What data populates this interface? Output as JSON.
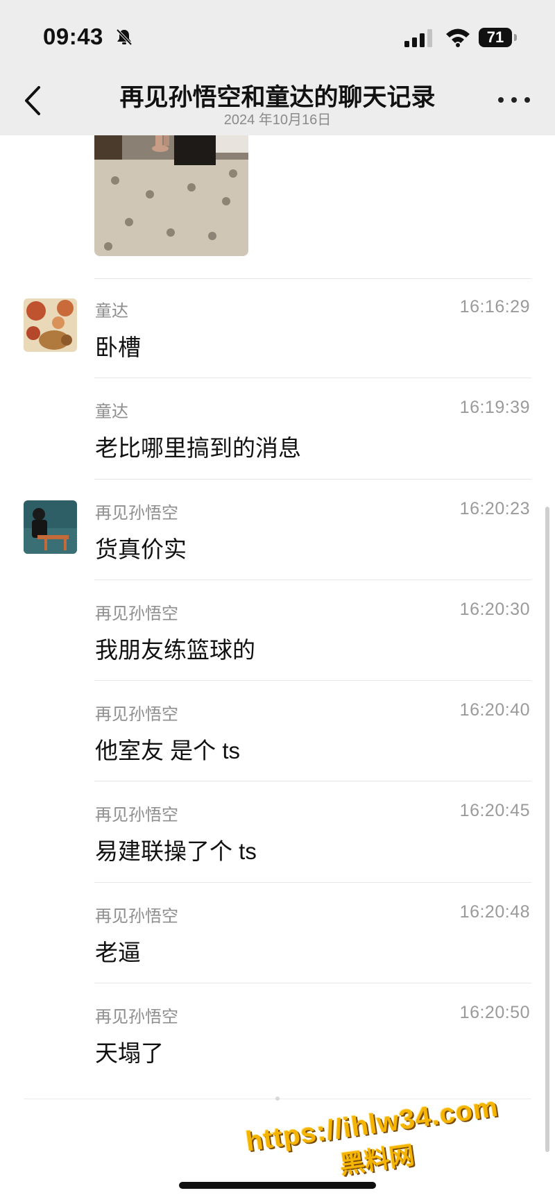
{
  "status_bar": {
    "time": "09:43",
    "battery": "71"
  },
  "nav": {
    "title": "再见孙悟空和童达的聊天记录",
    "subtitle": "2024 年10月16日"
  },
  "messages": [
    {
      "sender": "童达",
      "time": "16:16:29",
      "text": "卧槽"
    },
    {
      "sender": "童达",
      "time": "16:19:39",
      "text": "老比哪里搞到的消息"
    },
    {
      "sender": "再见孙悟空",
      "time": "16:20:23",
      "text": "货真价实"
    },
    {
      "sender": "再见孙悟空",
      "time": "16:20:30",
      "text": "我朋友练篮球的"
    },
    {
      "sender": "再见孙悟空",
      "time": "16:20:40",
      "text": "他室友 是个 ts"
    },
    {
      "sender": "再见孙悟空",
      "time": "16:20:45",
      "text": "易建联操了个 ts"
    },
    {
      "sender": "再见孙悟空",
      "time": "16:20:48",
      "text": "老逼"
    },
    {
      "sender": "再见孙悟空",
      "time": "16:20:50",
      "text": "天塌了"
    }
  ],
  "watermark": {
    "url": "https://ihlw34.com",
    "site": "黑料网"
  },
  "colors": {
    "nav_bg": "#ededed",
    "watermark": "#f4b400",
    "separator": "#e6e6e6"
  },
  "icons": [
    "bell-off-icon",
    "cellular-signal-icon",
    "wifi-icon",
    "battery-icon",
    "back-chevron-icon",
    "more-icon"
  ]
}
